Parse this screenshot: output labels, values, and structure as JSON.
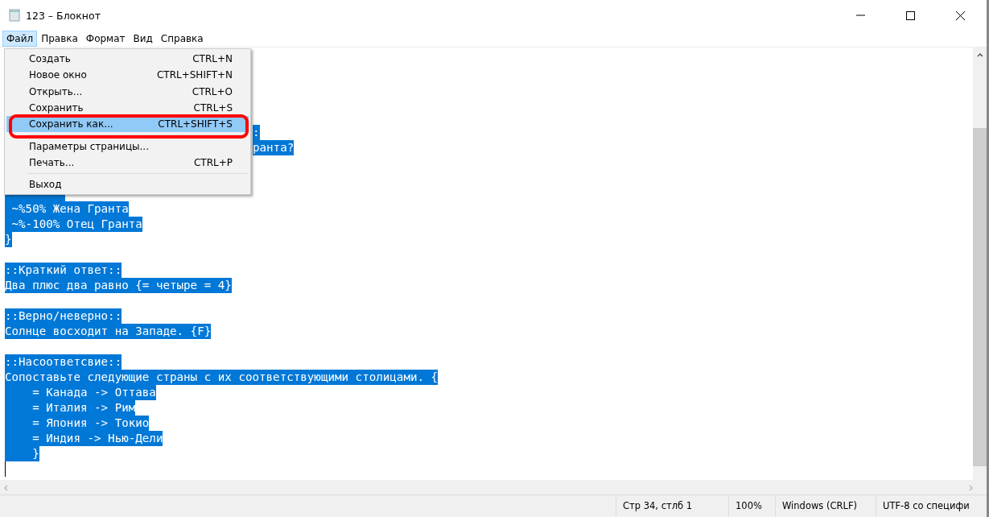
{
  "window": {
    "title": "123 – Блокнот"
  },
  "menu_bar": [
    {
      "label": "Файл",
      "selected": true
    },
    {
      "label": "Правка",
      "selected": false
    },
    {
      "label": "Формат",
      "selected": false
    },
    {
      "label": "Вид",
      "selected": false
    },
    {
      "label": "Справка",
      "selected": false
    }
  ],
  "file_menu": [
    {
      "kind": "item",
      "label": "Создать",
      "shortcut": "CTRL+N",
      "selected": false
    },
    {
      "kind": "item",
      "label": "Новое окно",
      "shortcut": "CTRL+SHIFT+N",
      "selected": false
    },
    {
      "kind": "item",
      "label": "Открыть...",
      "shortcut": "CTRL+O",
      "selected": false
    },
    {
      "kind": "item",
      "label": "Сохранить",
      "shortcut": "CTRL+S",
      "selected": false
    },
    {
      "kind": "item",
      "label": "Сохранить как...",
      "shortcut": "CTRL+SHIFT+S",
      "selected": true
    },
    {
      "kind": "separator"
    },
    {
      "kind": "item",
      "label": "Параметры страницы...",
      "selected": false
    },
    {
      "kind": "item",
      "label": "Печать...",
      "shortcut": "CTRL+P",
      "selected": false
    },
    {
      "kind": "separator"
    },
    {
      "kind": "item",
      "label": "Выход",
      "selected": false
    }
  ],
  "editor_lines": [
    {
      "kind": "fragment",
      "text": ":",
      "selected": true
    },
    {
      "kind": "fragment",
      "text": "ранта?",
      "selected": true
    },
    {
      "kind": "blank"
    },
    {
      "kind": "blank"
    },
    {
      "kind": "partial",
      "selected": true
    },
    {
      "kind": "text",
      "text": " ~%50% Жена Гранта",
      "selected": true
    },
    {
      "kind": "text",
      "text": " ~%-100% Отец Гранта",
      "selected": true
    },
    {
      "kind": "text",
      "text": "}",
      "selected": true
    },
    {
      "kind": "blank"
    },
    {
      "kind": "text",
      "text": "::Краткий ответ::",
      "selected": true
    },
    {
      "kind": "text",
      "text": "Два плюс два равно {= четыре = 4}",
      "selected": true
    },
    {
      "kind": "blank"
    },
    {
      "kind": "text",
      "text": "::Верно/неверно::",
      "selected": true
    },
    {
      "kind": "text",
      "text": "Солнце восходит на Западе. {F}",
      "selected": true
    },
    {
      "kind": "blank"
    },
    {
      "kind": "text",
      "text": "::Насоответсвие::",
      "selected": true
    },
    {
      "kind": "text",
      "text": "Сопоставьте следующие страны с их соответствующими столицами. {",
      "selected": true
    },
    {
      "kind": "text",
      "text": "    = Канада -> Оттава",
      "selected": true
    },
    {
      "kind": "text",
      "text": "    = Италия -> Рим",
      "selected": true
    },
    {
      "kind": "text",
      "text": "    = Япония -> Токио",
      "selected": true
    },
    {
      "kind": "text",
      "text": "    = Индия -> Нью-Дели",
      "selected": true
    },
    {
      "kind": "text",
      "text": "    }",
      "selected": true
    },
    {
      "kind": "cursor",
      "selected": false
    }
  ],
  "status_bar": [
    "Стр 34, стлб 1",
    "100%",
    "Windows (CRLF)",
    "UTF-8 со специфи"
  ]
}
